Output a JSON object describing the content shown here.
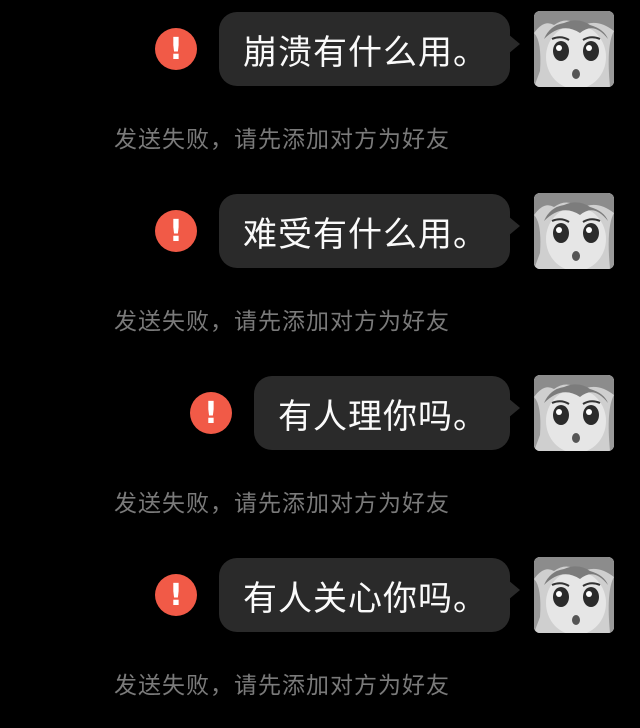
{
  "messages": [
    {
      "text": "崩溃有什么用。",
      "status": "发送失败，请先添加对方为好友"
    },
    {
      "text": "难受有什么用。",
      "status": "发送失败，请先添加对方为好友"
    },
    {
      "text": "有人理你吗。",
      "status": "发送失败，请先添加对方为好友"
    },
    {
      "text": "有人关心你吗。",
      "status": "发送失败，请先添加对方为好友"
    }
  ],
  "error_icon": {
    "glyph": "!",
    "icon": "error-exclamation-icon",
    "color": "#f15a47"
  },
  "colors": {
    "background": "#000000",
    "bubble": "#2a2a2a",
    "status_text": "#7a7a7a"
  }
}
